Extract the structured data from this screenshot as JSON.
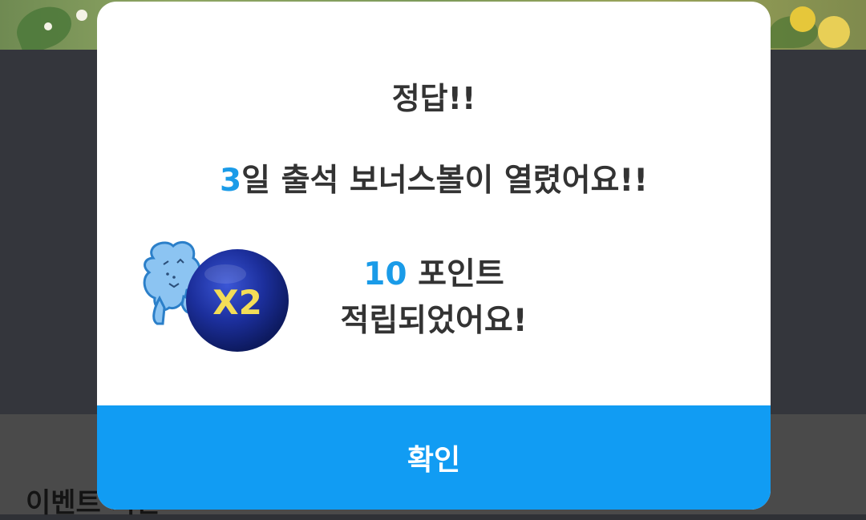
{
  "background": {
    "event_heading": "이벤트 기간"
  },
  "modal": {
    "title": "정답!!",
    "message_count": "3",
    "message_text": "일 출석 보너스볼이 열렸어요!!",
    "reward_badge": "X2",
    "points_value": "10",
    "points_unit": " 포인트",
    "points_text": "적립되었어요!",
    "confirm_label": "확인"
  },
  "colors": {
    "accent": "#1a9be8",
    "button": "#119cf3",
    "overlay": "#34363c"
  }
}
